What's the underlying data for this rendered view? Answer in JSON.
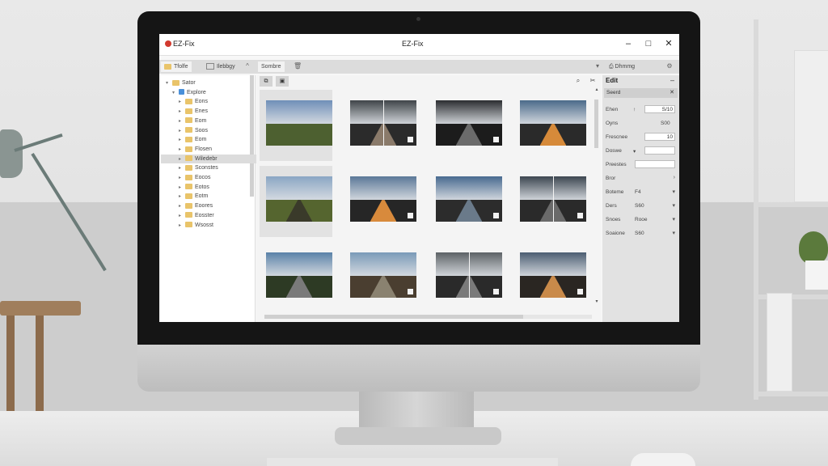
{
  "window": {
    "app_name": "EZ-Fix",
    "title": "EZ-Fix",
    "controls": {
      "minimize": "–",
      "maximize": "□",
      "close": "✕"
    }
  },
  "toolbar": {
    "left_tabs": [
      {
        "label": "Tfolfe",
        "icon": "folder-icon"
      },
      {
        "label": "Ilebbgy",
        "icon": "image-icon"
      }
    ],
    "collapse_glyph": "^",
    "center_tabs": [
      {
        "label": "Sombre"
      }
    ],
    "right_tabs": [
      {
        "label": "Dhmmg",
        "icon": "print-icon"
      }
    ]
  },
  "tree": {
    "items": [
      {
        "label": "Sator",
        "arrow": "▾",
        "depth": 0,
        "icon": "folder-icon",
        "selected": false
      },
      {
        "label": "Explore",
        "arrow": "▾",
        "depth": 1,
        "icon": "drive-icon",
        "selected": false
      },
      {
        "label": "Eons",
        "arrow": "▸",
        "depth": 2,
        "icon": "folder-icon",
        "selected": false
      },
      {
        "label": "Enes",
        "arrow": "▸",
        "depth": 2,
        "icon": "folder-icon",
        "selected": false
      },
      {
        "label": "Eom",
        "arrow": "▸",
        "depth": 2,
        "icon": "folder-icon",
        "selected": false
      },
      {
        "label": "Soos",
        "arrow": "▸",
        "depth": 2,
        "icon": "folder-icon",
        "selected": false
      },
      {
        "label": "Eom",
        "arrow": "▸",
        "depth": 2,
        "icon": "folder-icon",
        "selected": false
      },
      {
        "label": "Flosen",
        "arrow": "▸",
        "depth": 2,
        "icon": "folder-icon",
        "selected": false
      },
      {
        "label": "Wiledebr",
        "arrow": "▸",
        "depth": 2,
        "icon": "folder-icon",
        "selected": true
      },
      {
        "label": "Sconstes",
        "arrow": "▸",
        "depth": 2,
        "icon": "folder-icon",
        "selected": false
      },
      {
        "label": "Eocos",
        "arrow": "▸",
        "depth": 2,
        "icon": "folder-icon",
        "selected": false
      },
      {
        "label": "Eotos",
        "arrow": "▸",
        "depth": 2,
        "icon": "folder-icon",
        "selected": false
      },
      {
        "label": "Eotm",
        "arrow": "▸",
        "depth": 2,
        "icon": "folder-icon",
        "selected": false
      },
      {
        "label": "Eoores",
        "arrow": "▸",
        "depth": 2,
        "icon": "folder-icon",
        "selected": false
      },
      {
        "label": "Eosster",
        "arrow": "▸",
        "depth": 2,
        "icon": "folder-icon",
        "selected": false
      },
      {
        "label": "Wsosst",
        "arrow": "▸",
        "depth": 2,
        "icon": "folder-icon",
        "selected": false
      }
    ]
  },
  "grid": {
    "view_buttons": [
      "⧉",
      "▣"
    ],
    "tools": {
      "zoom": "⌕",
      "crop": "✂"
    },
    "thumbnails": [
      {
        "sky": "#6f8fb8",
        "ground": "#4d6030",
        "road": "none",
        "split": false,
        "badge": false,
        "selected": true
      },
      {
        "sky": "#3f4448",
        "ground": "#2b2b2b",
        "road": "#8a7a6a",
        "split": true,
        "badge": true,
        "selected": false
      },
      {
        "sky": "#2b2d30",
        "ground": "#1c1c1c",
        "road": "#6b6b6b",
        "split": false,
        "badge": true,
        "selected": false
      },
      {
        "sky": "#4a6a8a",
        "ground": "#2a2a2a",
        "road": "#d68a3a",
        "split": false,
        "badge": false,
        "selected": false
      },
      {
        "sky": "#8aa6c4",
        "ground": "#55652f",
        "road": "#3a3a2a",
        "split": false,
        "badge": false,
        "selected": true
      },
      {
        "sky": "#5b7898",
        "ground": "#262626",
        "road": "#d88a3c",
        "split": false,
        "badge": true,
        "selected": false
      },
      {
        "sky": "#486a90",
        "ground": "#2c2c2c",
        "road": "#6a7a8a",
        "split": false,
        "badge": true,
        "selected": false
      },
      {
        "sky": "#3c4650",
        "ground": "#2a2a2a",
        "road": "#6a6a6a",
        "split": true,
        "badge": true,
        "selected": false
      },
      {
        "sky": "#5a82a8",
        "ground": "#2d3a24",
        "road": "#7a7a7a",
        "split": false,
        "badge": false,
        "selected": false
      },
      {
        "sky": "#7a9ab8",
        "ground": "#4a3e30",
        "road": "#8a8270",
        "split": false,
        "badge": true,
        "selected": false
      },
      {
        "sky": "#5d6266",
        "ground": "#2a2a2a",
        "road": "#7a7a7a",
        "split": true,
        "badge": true,
        "selected": false
      },
      {
        "sky": "#4c5e72",
        "ground": "#2a2622",
        "road": "#c98a4a",
        "split": false,
        "badge": true,
        "selected": false
      }
    ]
  },
  "panel": {
    "title": "Edit",
    "title_glyph": "–",
    "section_label": "Seerd",
    "section_glyph": "✕",
    "rows": [
      {
        "label": "Ehen",
        "value": "S/10",
        "kind": "field-with-icon",
        "icon": "↑"
      },
      {
        "label": "Oyns",
        "value": "S00",
        "kind": "value"
      },
      {
        "label": "Frescnee",
        "value": "10",
        "kind": "field"
      },
      {
        "label": "Doswe",
        "value": "",
        "kind": "select"
      },
      {
        "label": "Preestes",
        "value": "",
        "kind": "field-wide"
      },
      {
        "label": "Bror",
        "value": "",
        "kind": "chevron"
      },
      {
        "label": "Boteme",
        "value": "F4",
        "kind": "select-value"
      },
      {
        "label": "Ders",
        "value": "S60",
        "kind": "select-value"
      },
      {
        "label": "Snoes",
        "value": "Rooe",
        "kind": "select-value"
      },
      {
        "label": "Soaione",
        "value": "S60",
        "kind": "select-value"
      }
    ]
  },
  "colors": {
    "accent": "#d23a2f",
    "folder": "#e9c46a",
    "selected_row": "#dcdcdc",
    "panel_bg": "#e2e2e2"
  }
}
